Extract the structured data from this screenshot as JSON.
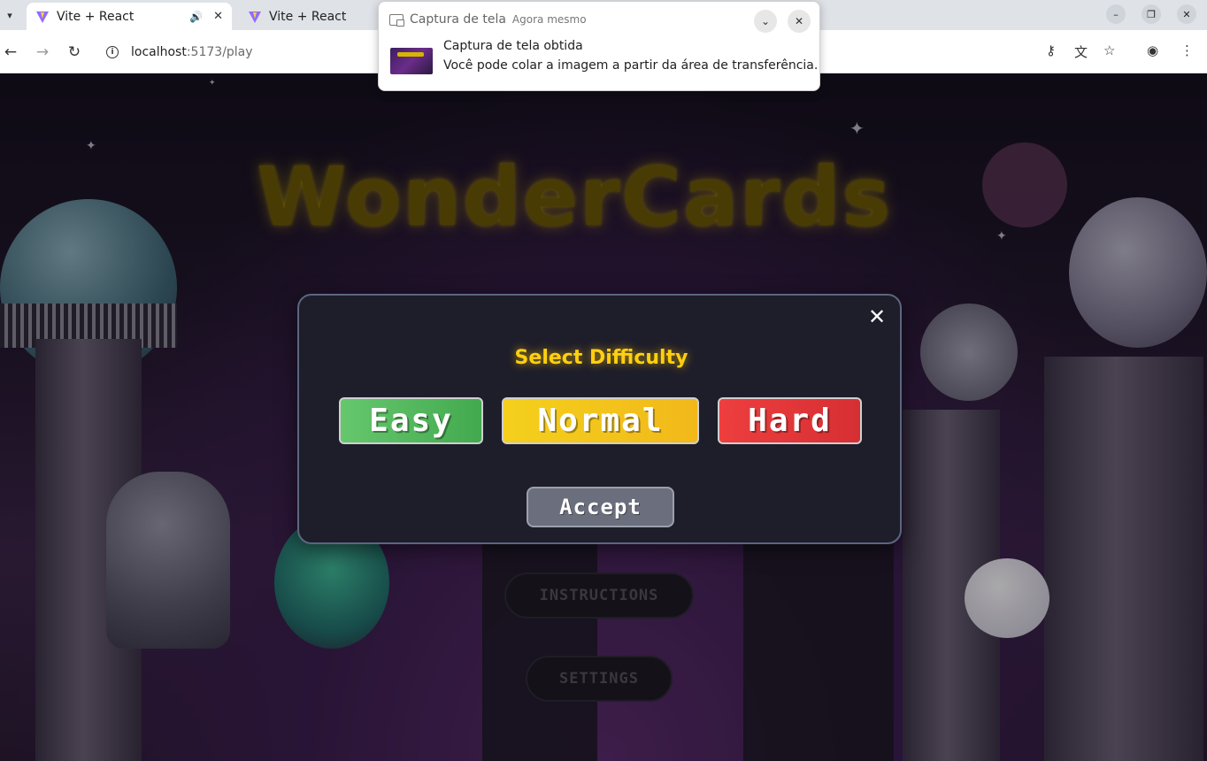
{
  "browser": {
    "tabs": [
      {
        "title": "Vite + React",
        "active": true
      },
      {
        "title": "Vite + React",
        "active": false
      }
    ],
    "url_host": "localhost",
    "url_path": ":5173/play"
  },
  "notification": {
    "app": "Captura de tela",
    "time": "Agora mesmo",
    "title": "Captura de tela obtida",
    "body": "Você pode colar a imagem a partir da área de transferência."
  },
  "game": {
    "logo": "WonderCards",
    "menu": {
      "instructions": "INSTRUCTIONS",
      "settings": "SETTINGS"
    }
  },
  "modal": {
    "title": "Select Difficulty",
    "close_symbol": "✕",
    "options": {
      "easy": "Easy",
      "normal": "Normal",
      "hard": "Hard"
    },
    "accept": "Accept"
  },
  "colors": {
    "easy": "#4fb65a",
    "normal": "#f5c51a",
    "hard": "#e53939",
    "title": "#ffcf10"
  }
}
